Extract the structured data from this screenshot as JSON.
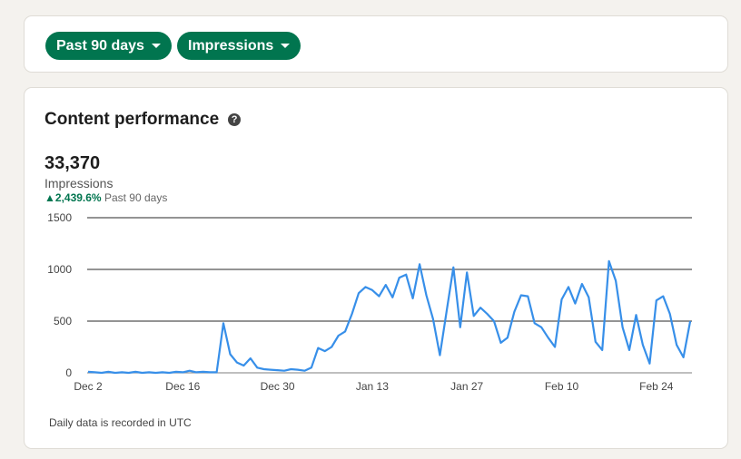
{
  "filters": {
    "range_label": "Past 90 days",
    "metric_label": "Impressions"
  },
  "panel": {
    "title": "Content performance",
    "help_icon": "?",
    "total": "33,370",
    "metric": "Impressions",
    "change": "2,439.6%",
    "change_period": "Past 90 days",
    "footnote": "Daily data is recorded in UTC"
  },
  "colors": {
    "accent": "#01754f",
    "line": "#378fe9"
  },
  "chart_data": {
    "type": "line",
    "title": "",
    "xlabel": "",
    "ylabel": "Impressions",
    "ylim": [
      0,
      1500
    ],
    "yticks": [
      "0",
      "500",
      "1000",
      "1500"
    ],
    "xticks": [
      {
        "label": "Dec 2",
        "day": 0
      },
      {
        "label": "Dec 16",
        "day": 14
      },
      {
        "label": "Dec 30",
        "day": 28
      },
      {
        "label": "Jan 13",
        "day": 42
      },
      {
        "label": "Jan 27",
        "day": 56
      },
      {
        "label": "Feb 10",
        "day": 70
      },
      {
        "label": "Feb 24",
        "day": 84
      }
    ],
    "values": [
      10,
      5,
      0,
      10,
      0,
      5,
      0,
      10,
      0,
      5,
      0,
      5,
      0,
      10,
      5,
      20,
      5,
      10,
      5,
      5,
      480,
      180,
      100,
      70,
      140,
      50,
      35,
      30,
      25,
      20,
      35,
      30,
      20,
      50,
      240,
      210,
      250,
      360,
      400,
      570,
      770,
      830,
      800,
      740,
      850,
      730,
      920,
      950,
      720,
      1050,
      750,
      520,
      170,
      600,
      1020,
      440,
      970,
      550,
      630,
      570,
      500,
      290,
      340,
      590,
      750,
      740,
      480,
      440,
      340,
      250,
      710,
      830,
      670,
      860,
      730,
      300,
      220,
      1080,
      890,
      440,
      220,
      560,
      270,
      90,
      700,
      740,
      570,
      270,
      150,
      500
    ]
  }
}
